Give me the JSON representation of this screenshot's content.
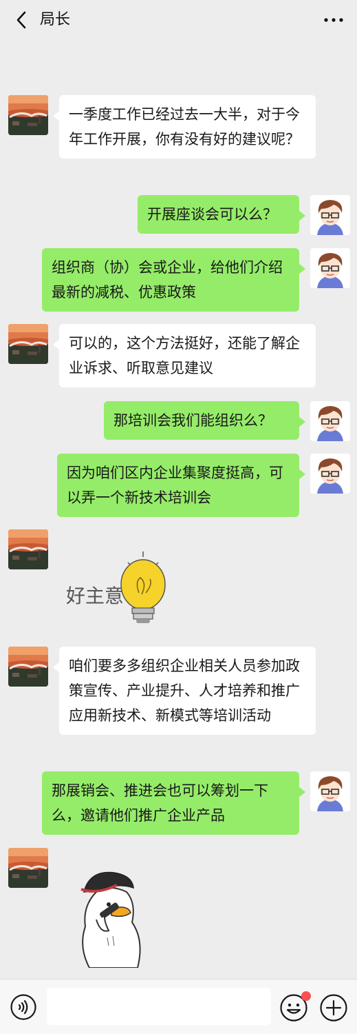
{
  "header": {
    "back_icon": "chevron-left-icon",
    "title": "局长",
    "more_icon": "more-dots-icon"
  },
  "messages": [
    {
      "sender": "other",
      "text": "一季度工作已经过去一大半，对于今年工作开展，你有没有好的建议呢？"
    },
    {
      "sender": "me",
      "text": "开展座谈会可以么？"
    },
    {
      "sender": "me",
      "text": "组织商（协）会或企业，给他们介绍最新的减税、优惠政策"
    },
    {
      "sender": "other",
      "text": "可以的，这个方法挺好，还能了解企业诉求、听取意见建议"
    },
    {
      "sender": "me",
      "text": "那培训会我们能组织么？"
    },
    {
      "sender": "me",
      "text": "因为咱们区内企业集聚度挺高，可以弄一个新技术培训会"
    },
    {
      "sender": "other",
      "sticker": "lightbulb-sticker",
      "sticker_text": "好主意"
    },
    {
      "sender": "other",
      "text": "咱们要多多组织企业相关人员参加政策宣传、产业提升、人才培养和推广应用新技术、新模式等培训活动"
    },
    {
      "sender": "me",
      "text": "那展销会、推进会也可以筹划一下么，邀请他们推广企业产品"
    },
    {
      "sender": "other",
      "sticker": "duck-phone-sticker"
    }
  ],
  "input_bar": {
    "voice_icon": "voice-icon",
    "text_value": "",
    "emoji_icon": "emoji-icon",
    "plus_icon": "plus-icon"
  },
  "colors": {
    "background": "#ededed",
    "incoming_bubble": "#ffffff",
    "outgoing_bubble": "#95ec69",
    "notification_dot": "#fa5151"
  }
}
